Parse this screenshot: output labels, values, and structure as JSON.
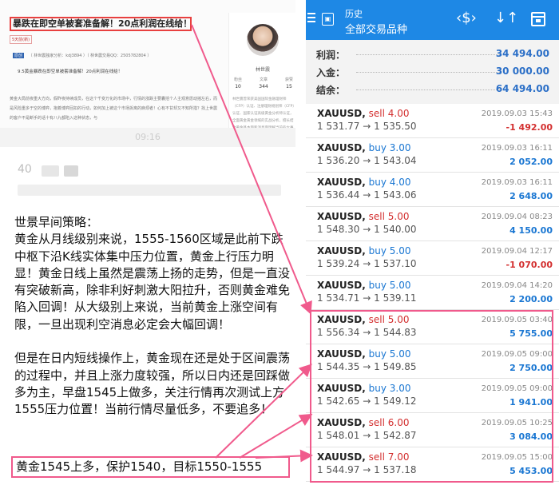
{
  "article": {
    "headline": "暴跌在即空单被套准备解！20点利润在线给！",
    "tag": "5天前(新)",
    "meta_tag": "原创",
    "meta_text": "（ 林世震独家分析：kdj3894 ）（ 林世震交易QQ：2505782804 ）",
    "subline": "9.5黄金暴跌在即空单被套准备解！20点利润在线给！",
    "para": "黄金大局前夜重大方向，假昨夜持续成员，在这个千变万化的市场中，行情的涨跌主要囊括个人主观意愿动摇左右，而是风险重多于空的博弈，抱着博弈回扣的行动，如何加上被这个市场拆离的麻烦者！心有不甘却又不知所措？找上世震的客户不是断手的话十有八九都陷入这种状态，与",
    "time": "09:16",
    "blur_row1": "40",
    "blur_row2": "c ⃝ ⃞ ⃞ ⃞  ⃞ ⃞ . ⃞ ⃞ ⃞"
  },
  "profile": {
    "name": "林世震",
    "stats": [
      {
        "label": "粉丝",
        "value": "10"
      },
      {
        "label": "文章",
        "value": "344"
      },
      {
        "label": "获赞",
        "value": "15"
      }
    ],
    "bio": "林世震曾荣获美国国际金融理财师（CFP）认证、注册理财规划师（CFP）认证、国家认证高级黄金分析师认证，全面黄金黄金领域的实战分析，擅长结合黄金基本面和消息面理解当前的大事件及国内外汇及黄金个人投资的用户"
  },
  "strategy": {
    "paragraphs": [
      "世景早间策略：",
      "黄金从月线级别来说，1555-1560区域是此前下跌中枢下沿K线实体集中压力位置，黄金上行压力明显！黄金日线上虽然是震荡上扬的走势，但是一直没有突破新高，除非利好刺激大阳拉升，否则黄金难免陷入回调！从大级别上来说，当前黄金上涨空间有限，一旦出现利空消息必定会大幅回调！",
      "但是在日内短线操作上，黄金现在还是处于区间震荡的过程中，并且上涨力度较强，所以日内还是回踩做多为主，早盘1545上做多，关注行情再次测试上方1555压力位置！当前行情尽量低多，不要追多！"
    ],
    "callout": "黄金1545上多，保护1540，目标1550-1555"
  },
  "app": {
    "title_small": "历史",
    "title_big": "全部交易品种",
    "icons": [
      "menu-icon",
      "app-icon",
      "currency-sort-icon",
      "sort-arrows-icon",
      "calendar-icon"
    ],
    "summary": [
      {
        "label": "利润：",
        "value": "34 494.00"
      },
      {
        "label": "入金：",
        "value": "30 000.00"
      },
      {
        "label": "结余：",
        "value": "64 494.00"
      }
    ],
    "trades": [
      {
        "symbol": "XAUUSD,",
        "side": "sell 4.00",
        "type": "sell",
        "prices": "1 531.77 → 1 535.50",
        "date": "2019.09.03 15:43",
        "profit": "-1 492.00",
        "neg": true
      },
      {
        "symbol": "XAUUSD,",
        "side": "buy 3.00",
        "type": "buy",
        "prices": "1 536.20 → 1 543.04",
        "date": "2019.09.03 16:11",
        "profit": "2 052.00",
        "neg": false
      },
      {
        "symbol": "XAUUSD,",
        "side": "buy 4.00",
        "type": "buy",
        "prices": "1 536.44 → 1 543.06",
        "date": "2019.09.03 16:11",
        "profit": "2 648.00",
        "neg": false
      },
      {
        "symbol": "XAUUSD,",
        "side": "sell 5.00",
        "type": "sell",
        "prices": "1 548.30 → 1 540.00",
        "date": "2019.09.04 08:23",
        "profit": "4 150.00",
        "neg": false
      },
      {
        "symbol": "XAUUSD,",
        "side": "buy 5.00",
        "type": "buy",
        "prices": "1 539.24 → 1 537.10",
        "date": "2019.09.04 12:17",
        "profit": "-1 070.00",
        "neg": true
      },
      {
        "symbol": "XAUUSD,",
        "side": "buy 5.00",
        "type": "buy",
        "prices": "1 534.71 → 1 539.11",
        "date": "2019.09.04 14:20",
        "profit": "2 200.00",
        "neg": false
      },
      {
        "symbol": "XAUUSD,",
        "side": "sell 5.00",
        "type": "sell",
        "prices": "1 556.34 → 1 544.83",
        "date": "2019.09.05 03:40",
        "profit": "5 755.00",
        "neg": false
      },
      {
        "symbol": "XAUUSD,",
        "side": "buy 5.00",
        "type": "buy",
        "prices": "1 544.35 → 1 549.85",
        "date": "2019.09.05 09:00",
        "profit": "2 750.00",
        "neg": false
      },
      {
        "symbol": "XAUUSD,",
        "side": "buy 3.00",
        "type": "buy",
        "prices": "1 542.65 → 1 549.12",
        "date": "2019.09.05 09:00",
        "profit": "1 941.00",
        "neg": false
      },
      {
        "symbol": "XAUUSD,",
        "side": "sell 6.00",
        "type": "sell",
        "prices": "1 548.01 → 1 542.87",
        "date": "2019.09.05 10:25",
        "profit": "3 084.00",
        "neg": false
      },
      {
        "symbol": "XAUUSD,",
        "side": "sell 7.00",
        "type": "sell",
        "prices": "1 544.97 → 1 537.18",
        "date": "2019.09.05 15:00",
        "profit": "5 453.00",
        "neg": false
      }
    ]
  },
  "colors": {
    "app_blue": "#1e88e5",
    "highlight_pink": "#f05a8c",
    "headline_red": "#e8403f",
    "profit_blue": "#1976d2",
    "loss_red": "#d32f2f"
  }
}
